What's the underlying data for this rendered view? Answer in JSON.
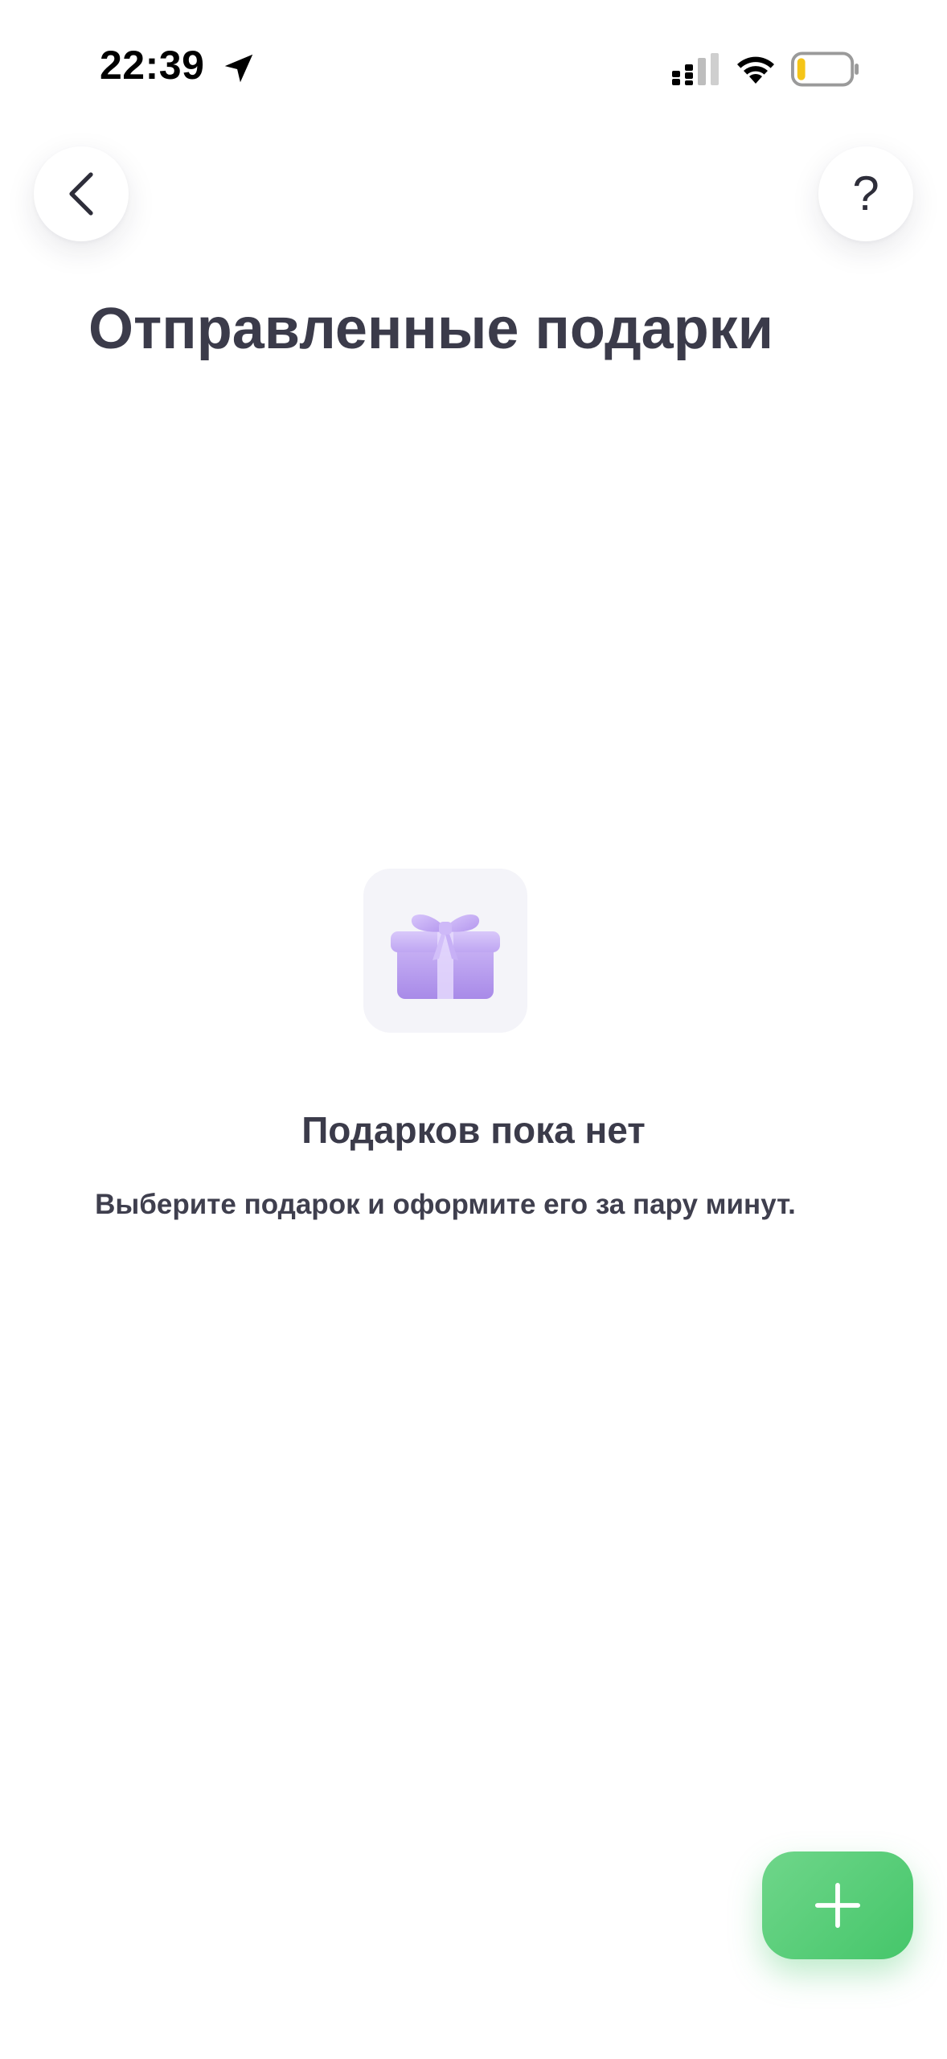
{
  "status_bar": {
    "time": "22:39",
    "icons": [
      "location-arrow-icon",
      "cellular-signal-icon",
      "wifi-icon",
      "battery-low-icon"
    ],
    "battery_color": "#f5c518"
  },
  "header": {
    "back_icon": "chevron-left-icon",
    "help_label": "?",
    "title": "Отправленные подарки"
  },
  "empty_state": {
    "icon": "gift-icon",
    "title": "Подарков пока нет",
    "subtitle": "Выберите подарок и оформите его за пару минут."
  },
  "fab": {
    "icon": "plus-icon",
    "color": "#4cc86f"
  }
}
